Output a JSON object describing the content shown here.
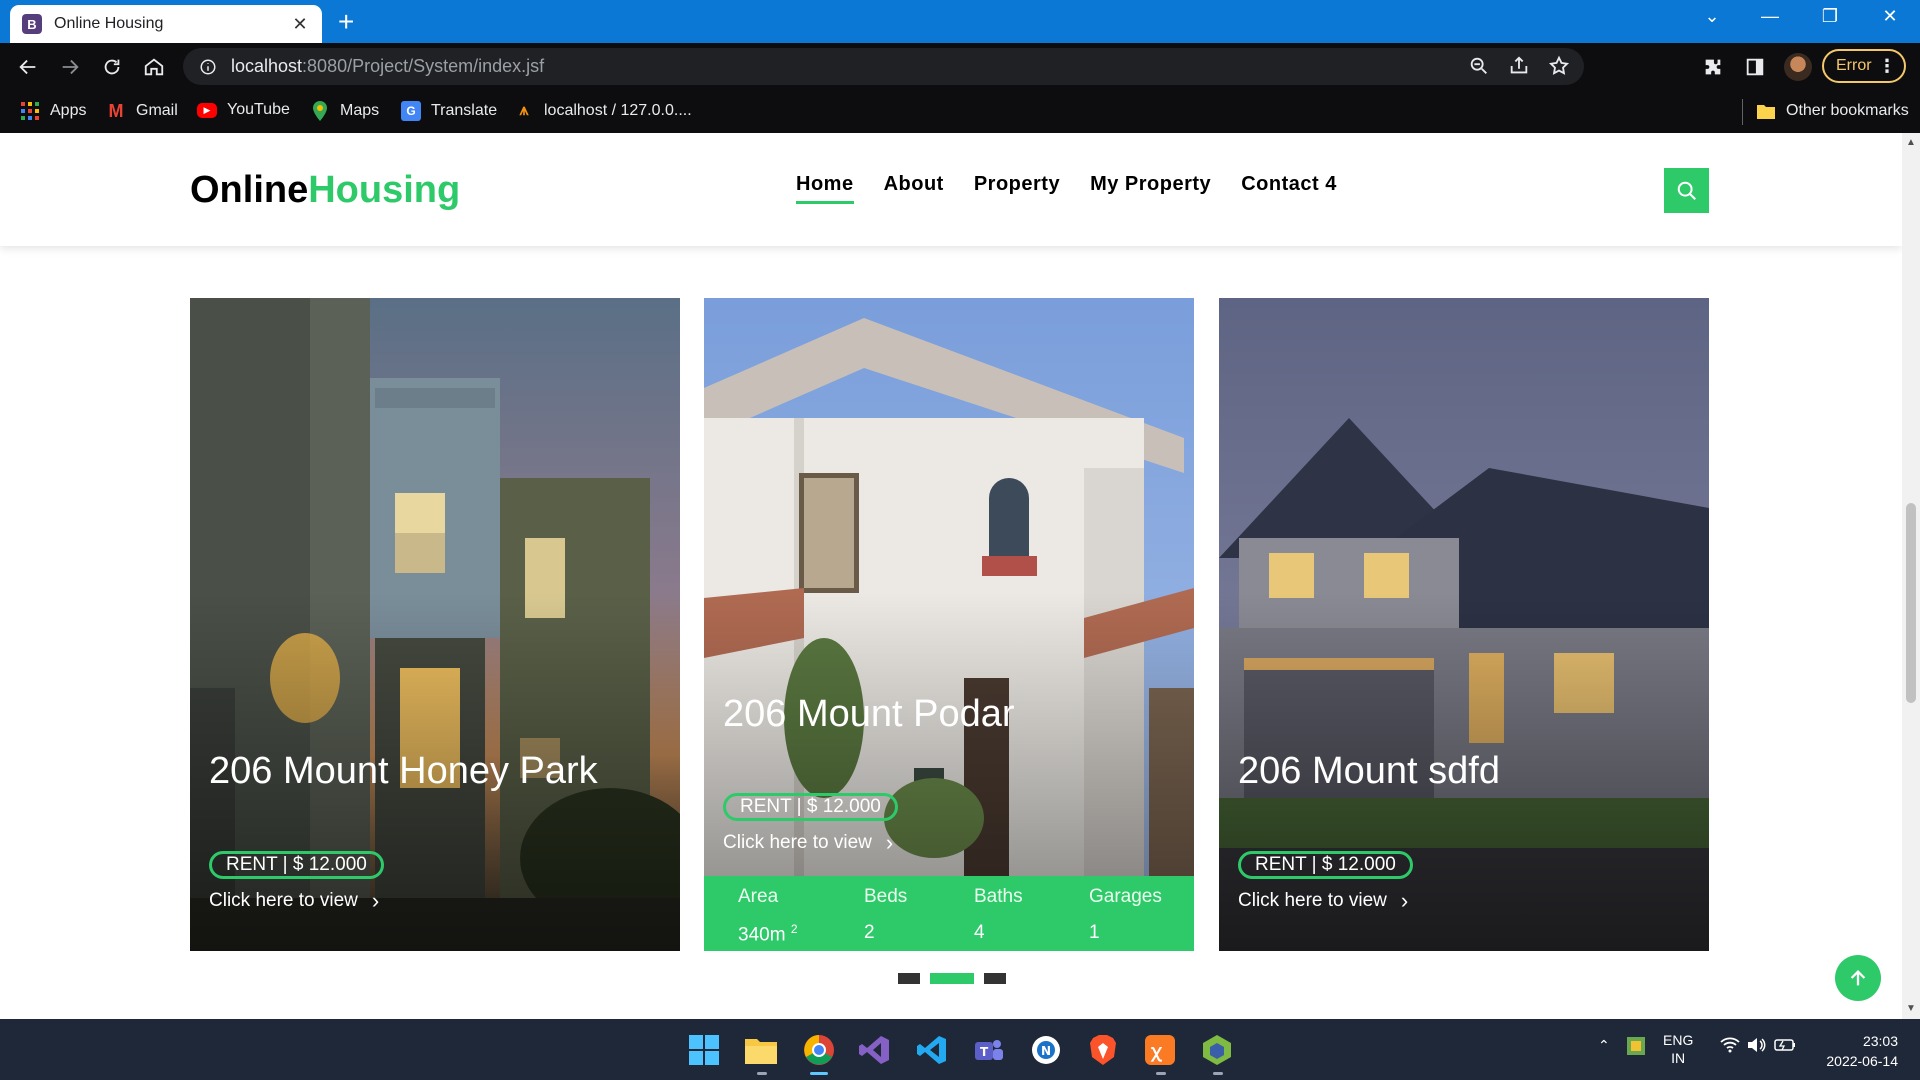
{
  "browser": {
    "tab_title": "Online Housing",
    "tab_favicon": "B",
    "url_host": "localhost",
    "url_path": ":8080/Project/System/index.jsf",
    "error_label": "Error",
    "bookmarks": [
      "Apps",
      "Gmail",
      "YouTube",
      "Maps",
      "Translate",
      "localhost / 127.0.0...."
    ],
    "other_bookmarks": "Other bookmarks"
  },
  "site": {
    "logo_primary": "Online",
    "logo_accent": "Housing",
    "nav": [
      "Home",
      "About",
      "Property",
      "My Property",
      "Contact 4"
    ],
    "active_nav": "Home",
    "accent_color": "#2eca6a"
  },
  "cards": [
    {
      "title": "206 Mount Honey Park",
      "price": "RENT | $ 12.000",
      "link": "Click here to view"
    },
    {
      "title": "206 Mount Podar",
      "price": "RENT | $ 12.000",
      "link": "Click here to view",
      "stats": [
        {
          "label": "Area",
          "value": "340m",
          "sup": "2"
        },
        {
          "label": "Beds",
          "value": "2"
        },
        {
          "label": "Baths",
          "value": "4"
        },
        {
          "label": "Garages",
          "value": "1"
        }
      ]
    },
    {
      "title": "206 Mount sdfd",
      "price": "RENT | $ 12.000",
      "link": "Click here to view"
    }
  ],
  "carousel": {
    "slides": 3,
    "active": 1
  },
  "taskbar": {
    "lang_line1": "ENG",
    "lang_line2": "IN",
    "time": "23:03",
    "date": "2022-06-14"
  }
}
